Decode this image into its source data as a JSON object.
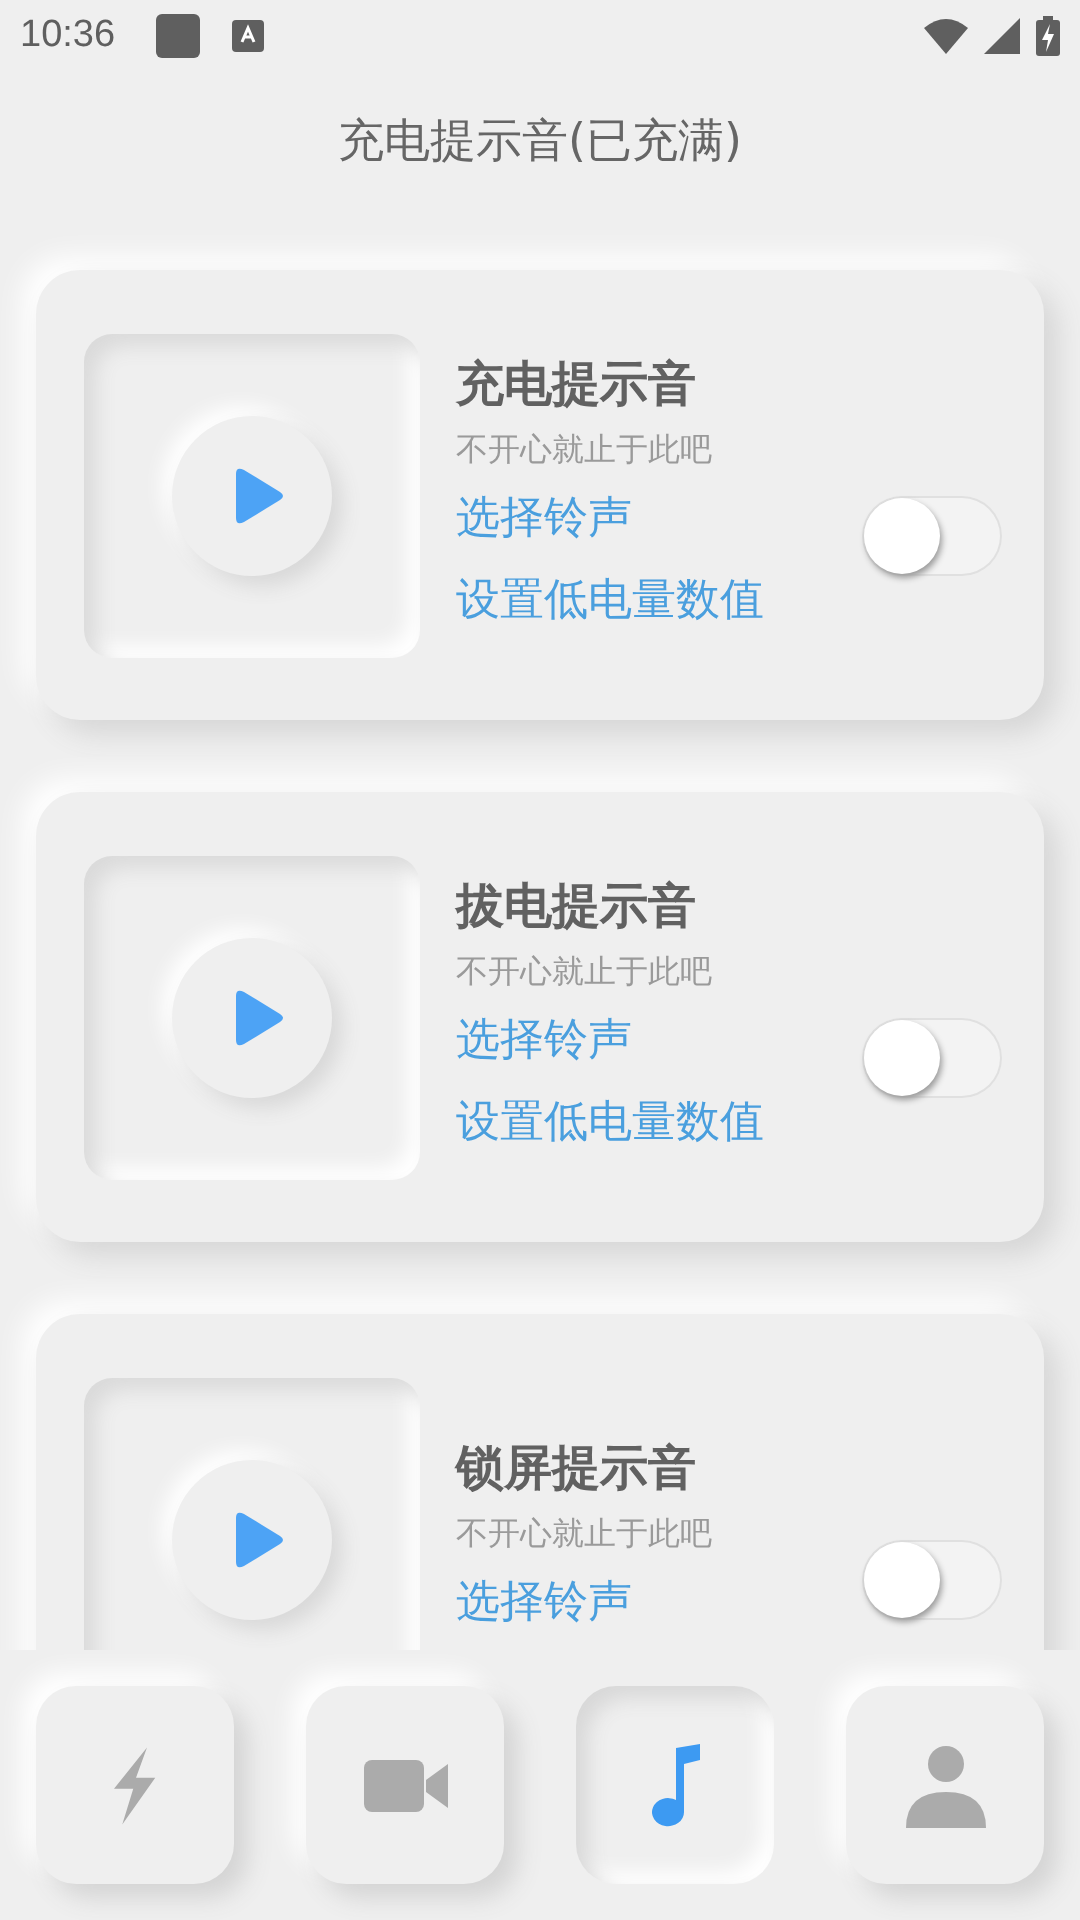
{
  "status_bar": {
    "time": "10:36"
  },
  "header": {
    "title": "充电提示音(已充满)"
  },
  "cards": [
    {
      "title": "充电提示音",
      "subtitle": "不开心就止于此吧",
      "links": [
        "选择铃声",
        "设置低电量数值"
      ],
      "on": false
    },
    {
      "title": "拔电提示音",
      "subtitle": "不开心就止于此吧",
      "links": [
        "选择铃声",
        "设置低电量数值"
      ],
      "on": false
    },
    {
      "title": "锁屏提示音",
      "subtitle": "不开心就止于此吧",
      "links": [
        "选择铃声"
      ],
      "on": false
    }
  ],
  "nav": [
    {
      "kind": "bolt",
      "selected": false
    },
    {
      "kind": "video",
      "selected": false
    },
    {
      "kind": "music",
      "selected": true
    },
    {
      "kind": "person",
      "selected": false
    }
  ]
}
